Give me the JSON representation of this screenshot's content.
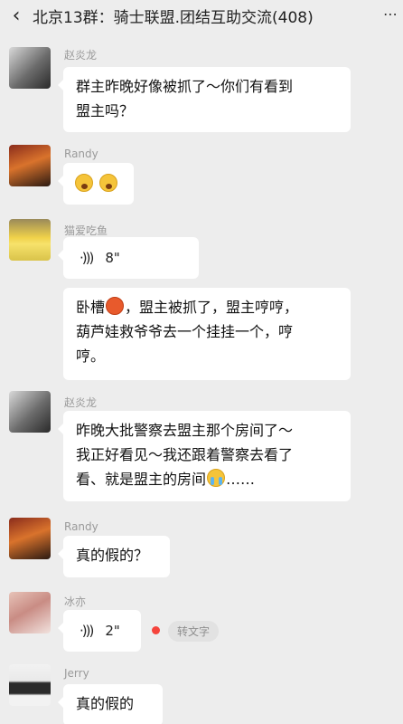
{
  "header": {
    "back_icon": "chevron-left-icon",
    "title": "北京13群：骑士联盟.团结互助交流(408)",
    "more_icon": "more-icon"
  },
  "messages": [
    {
      "sender": "赵炎龙",
      "text": "群主昨晚好像被抓了～你们有看到盟主吗？",
      "line1": "群主昨晚好像被抓了～你们有看到",
      "line2": "盟主吗？"
    },
    {
      "sender": "Randy",
      "emojis": [
        "shocked-emoji",
        "shocked-emoji"
      ]
    },
    {
      "sender": "猫爱吃鱼",
      "voice_duration": "8\""
    },
    {
      "sender": "猫爱吃鱼",
      "line1a": "卧槽",
      "line1b": "，盟主被抓了，盟主哼哼，",
      "line2": "葫芦娃救爷爷去一个挂挂一个，哼",
      "line3": "哼。"
    },
    {
      "sender": "赵炎龙",
      "line1": "昨晚大批警察去盟主那个房间了～",
      "line2": "我正好看见～我还跟着警察去看了",
      "line3a": "看、就是盟主的房间",
      "line3b": "……"
    },
    {
      "sender": "Randy",
      "text": "真的假的？"
    },
    {
      "sender": "冰亦",
      "voice_duration": "2\"",
      "to_text": "转文字"
    },
    {
      "sender": "Jerry",
      "text": "真的假的"
    }
  ]
}
